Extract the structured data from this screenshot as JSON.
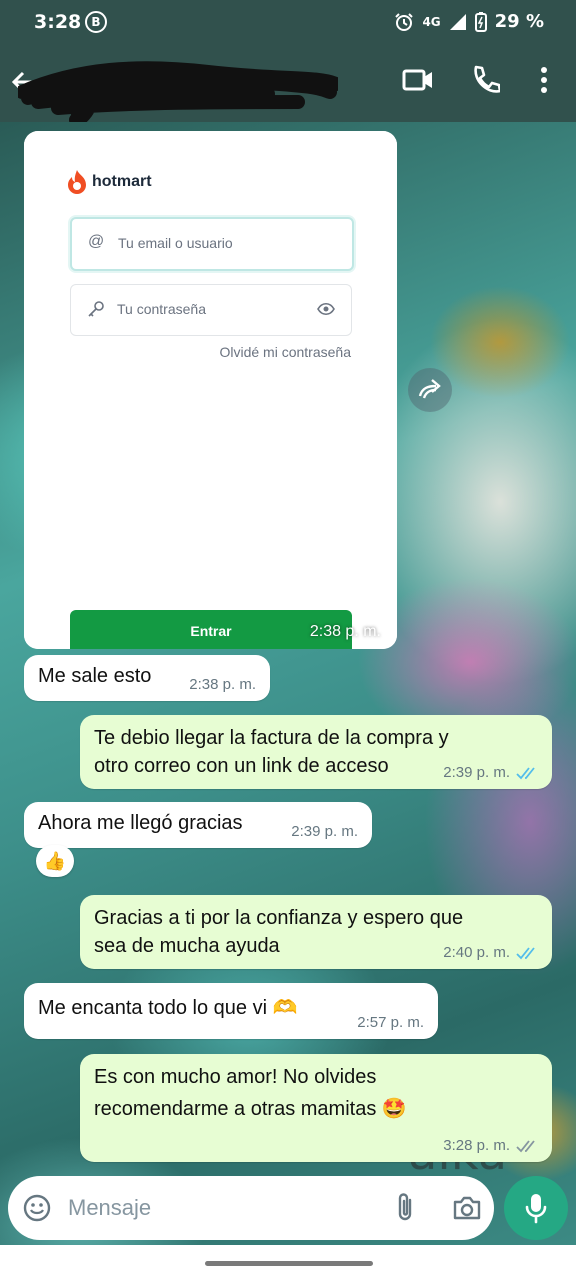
{
  "status_bar": {
    "time": "3:28",
    "notif_badge": "B",
    "network": "4G",
    "battery": "29 %"
  },
  "app_bar": {
    "contact_name": ""
  },
  "image_message": {
    "brand": "hotmart",
    "email_placeholder": "Tu email o usuario",
    "password_placeholder": "Tu contraseña",
    "forgot_password": "Olvidé mi contraseña",
    "submit_label": "Entrar",
    "time": "2:38 p. m."
  },
  "wallpaper_text": "aika",
  "messages": [
    {
      "text": "Me sale esto",
      "time": "2:38 p. m."
    },
    {
      "line1": "Te debio llegar la factura de la compra y",
      "line2": "otro correo con un link de acceso",
      "time": "2:39 p. m.",
      "status": "read"
    },
    {
      "text": "Ahora me llegó gracias",
      "time": "2:39 p. m.",
      "reaction": "👍"
    },
    {
      "line1": "Gracias a ti por la confianza y espero que",
      "line2": "sea de mucha ayuda",
      "time": "2:40 p. m.",
      "status": "read"
    },
    {
      "text": "Me encanta todo lo que vi 🫶",
      "time": "2:57 p. m."
    },
    {
      "line1": "Es con mucho amor! No olvides",
      "line2": "recomendarme a otras mamitas 🤩",
      "time": "3:28 p. m.",
      "status": "delivered"
    }
  ],
  "composer": {
    "placeholder": "Mensaje"
  },
  "colors": {
    "header": "#31514d",
    "incoming": "#ffffff",
    "outgoing": "#e7fdd3",
    "read_tick": "#53bdeb",
    "mic": "#25a884",
    "hotmart_btn": "#139a43"
  }
}
